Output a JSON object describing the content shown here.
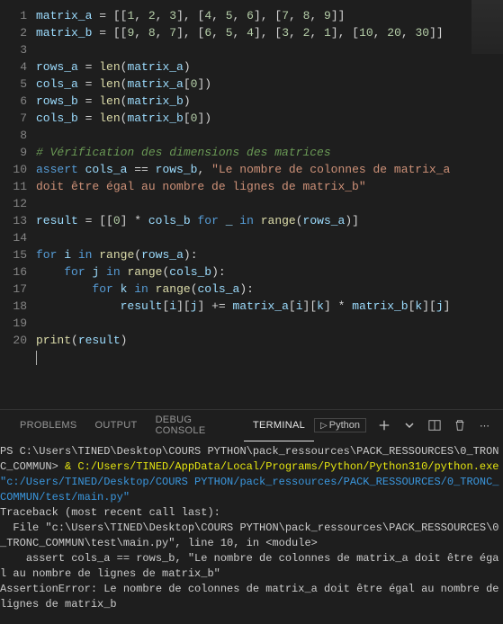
{
  "editor": {
    "lines": [
      {
        "n": "1",
        "tokens": [
          {
            "t": "var",
            "v": "matrix_a"
          },
          {
            "t": "op",
            "v": " = [["
          },
          {
            "t": "num",
            "v": "1"
          },
          {
            "t": "op",
            "v": ", "
          },
          {
            "t": "num",
            "v": "2"
          },
          {
            "t": "op",
            "v": ", "
          },
          {
            "t": "num",
            "v": "3"
          },
          {
            "t": "op",
            "v": "], ["
          },
          {
            "t": "num",
            "v": "4"
          },
          {
            "t": "op",
            "v": ", "
          },
          {
            "t": "num",
            "v": "5"
          },
          {
            "t": "op",
            "v": ", "
          },
          {
            "t": "num",
            "v": "6"
          },
          {
            "t": "op",
            "v": "], ["
          },
          {
            "t": "num",
            "v": "7"
          },
          {
            "t": "op",
            "v": ", "
          },
          {
            "t": "num",
            "v": "8"
          },
          {
            "t": "op",
            "v": ", "
          },
          {
            "t": "num",
            "v": "9"
          },
          {
            "t": "op",
            "v": "]]"
          }
        ]
      },
      {
        "n": "2",
        "tokens": [
          {
            "t": "var",
            "v": "matrix_b"
          },
          {
            "t": "op",
            "v": " = [["
          },
          {
            "t": "num",
            "v": "9"
          },
          {
            "t": "op",
            "v": ", "
          },
          {
            "t": "num",
            "v": "8"
          },
          {
            "t": "op",
            "v": ", "
          },
          {
            "t": "num",
            "v": "7"
          },
          {
            "t": "op",
            "v": "], ["
          },
          {
            "t": "num",
            "v": "6"
          },
          {
            "t": "op",
            "v": ", "
          },
          {
            "t": "num",
            "v": "5"
          },
          {
            "t": "op",
            "v": ", "
          },
          {
            "t": "num",
            "v": "4"
          },
          {
            "t": "op",
            "v": "], ["
          },
          {
            "t": "num",
            "v": "3"
          },
          {
            "t": "op",
            "v": ", "
          },
          {
            "t": "num",
            "v": "2"
          },
          {
            "t": "op",
            "v": ", "
          },
          {
            "t": "num",
            "v": "1"
          },
          {
            "t": "op",
            "v": "], ["
          },
          {
            "t": "num",
            "v": "10"
          },
          {
            "t": "op",
            "v": ", "
          },
          {
            "t": "num",
            "v": "20"
          },
          {
            "t": "op",
            "v": ", "
          },
          {
            "t": "num",
            "v": "30"
          },
          {
            "t": "op",
            "v": "]]"
          }
        ]
      },
      {
        "n": "3",
        "tokens": []
      },
      {
        "n": "4",
        "tokens": [
          {
            "t": "var",
            "v": "rows_a"
          },
          {
            "t": "op",
            "v": " = "
          },
          {
            "t": "fn",
            "v": "len"
          },
          {
            "t": "op",
            "v": "("
          },
          {
            "t": "var",
            "v": "matrix_a"
          },
          {
            "t": "op",
            "v": ")"
          }
        ]
      },
      {
        "n": "5",
        "tokens": [
          {
            "t": "var",
            "v": "cols_a"
          },
          {
            "t": "op",
            "v": " = "
          },
          {
            "t": "fn",
            "v": "len"
          },
          {
            "t": "op",
            "v": "("
          },
          {
            "t": "var",
            "v": "matrix_a"
          },
          {
            "t": "op",
            "v": "["
          },
          {
            "t": "num",
            "v": "0"
          },
          {
            "t": "op",
            "v": "])"
          }
        ]
      },
      {
        "n": "6",
        "tokens": [
          {
            "t": "var",
            "v": "rows_b"
          },
          {
            "t": "op",
            "v": " = "
          },
          {
            "t": "fn",
            "v": "len"
          },
          {
            "t": "op",
            "v": "("
          },
          {
            "t": "var",
            "v": "matrix_b"
          },
          {
            "t": "op",
            "v": ")"
          }
        ]
      },
      {
        "n": "7",
        "tokens": [
          {
            "t": "var",
            "v": "cols_b"
          },
          {
            "t": "op",
            "v": " = "
          },
          {
            "t": "fn",
            "v": "len"
          },
          {
            "t": "op",
            "v": "("
          },
          {
            "t": "var",
            "v": "matrix_b"
          },
          {
            "t": "op",
            "v": "["
          },
          {
            "t": "num",
            "v": "0"
          },
          {
            "t": "op",
            "v": "])"
          }
        ]
      },
      {
        "n": "8",
        "tokens": []
      },
      {
        "n": "9",
        "tokens": [
          {
            "t": "cmt",
            "v": "# Vérification des dimensions des matrices"
          }
        ]
      },
      {
        "n": "10",
        "tokens": [
          {
            "t": "kw",
            "v": "assert "
          },
          {
            "t": "var",
            "v": "cols_a"
          },
          {
            "t": "op",
            "v": " == "
          },
          {
            "t": "var",
            "v": "rows_b"
          },
          {
            "t": "op",
            "v": ", "
          },
          {
            "t": "str",
            "v": "\"Le nombre de colonnes de matrix_a "
          }
        ]
      },
      {
        "n": "",
        "tokens": [
          {
            "t": "str",
            "v": "doit être égal au nombre de lignes de matrix_b\""
          }
        ]
      },
      {
        "n": "11",
        "tokens": []
      },
      {
        "n": "12",
        "tokens": [
          {
            "t": "var",
            "v": "result"
          },
          {
            "t": "op",
            "v": " = [["
          },
          {
            "t": "num",
            "v": "0"
          },
          {
            "t": "op",
            "v": "] * "
          },
          {
            "t": "var",
            "v": "cols_b"
          },
          {
            "t": "kw",
            "v": " for "
          },
          {
            "t": "var",
            "v": "_"
          },
          {
            "t": "kw",
            "v": " in "
          },
          {
            "t": "fn",
            "v": "range"
          },
          {
            "t": "op",
            "v": "("
          },
          {
            "t": "var",
            "v": "rows_a"
          },
          {
            "t": "op",
            "v": ")]"
          }
        ]
      },
      {
        "n": "13",
        "tokens": []
      },
      {
        "n": "14",
        "tokens": [
          {
            "t": "kw",
            "v": "for "
          },
          {
            "t": "var",
            "v": "i"
          },
          {
            "t": "kw",
            "v": " in "
          },
          {
            "t": "fn",
            "v": "range"
          },
          {
            "t": "op",
            "v": "("
          },
          {
            "t": "var",
            "v": "rows_a"
          },
          {
            "t": "op",
            "v": "):"
          }
        ]
      },
      {
        "n": "15",
        "tokens": [
          {
            "t": "op",
            "v": "    "
          },
          {
            "t": "kw",
            "v": "for "
          },
          {
            "t": "var",
            "v": "j"
          },
          {
            "t": "kw",
            "v": " in "
          },
          {
            "t": "fn",
            "v": "range"
          },
          {
            "t": "op",
            "v": "("
          },
          {
            "t": "var",
            "v": "cols_b"
          },
          {
            "t": "op",
            "v": "):"
          }
        ]
      },
      {
        "n": "16",
        "tokens": [
          {
            "t": "op",
            "v": "        "
          },
          {
            "t": "kw",
            "v": "for "
          },
          {
            "t": "var",
            "v": "k"
          },
          {
            "t": "kw",
            "v": " in "
          },
          {
            "t": "fn",
            "v": "range"
          },
          {
            "t": "op",
            "v": "("
          },
          {
            "t": "var",
            "v": "cols_a"
          },
          {
            "t": "op",
            "v": "):"
          }
        ]
      },
      {
        "n": "17",
        "tokens": [
          {
            "t": "op",
            "v": "            "
          },
          {
            "t": "var",
            "v": "result"
          },
          {
            "t": "op",
            "v": "["
          },
          {
            "t": "var",
            "v": "i"
          },
          {
            "t": "op",
            "v": "]["
          },
          {
            "t": "var",
            "v": "j"
          },
          {
            "t": "op",
            "v": "] += "
          },
          {
            "t": "var",
            "v": "matrix_a"
          },
          {
            "t": "op",
            "v": "["
          },
          {
            "t": "var",
            "v": "i"
          },
          {
            "t": "op",
            "v": "]["
          },
          {
            "t": "var",
            "v": "k"
          },
          {
            "t": "op",
            "v": "] * "
          },
          {
            "t": "var",
            "v": "matrix_b"
          },
          {
            "t": "op",
            "v": "["
          },
          {
            "t": "var",
            "v": "k"
          },
          {
            "t": "op",
            "v": "]["
          },
          {
            "t": "var",
            "v": "j"
          },
          {
            "t": "op",
            "v": "]"
          }
        ]
      },
      {
        "n": "18",
        "tokens": []
      },
      {
        "n": "19",
        "tokens": [
          {
            "t": "fn",
            "v": "print"
          },
          {
            "t": "op",
            "v": "("
          },
          {
            "t": "var",
            "v": "result"
          },
          {
            "t": "op",
            "v": ")"
          }
        ]
      },
      {
        "n": "20",
        "tokens": []
      }
    ]
  },
  "panel": {
    "tabs": [
      {
        "label": "PROBLEMS",
        "active": false
      },
      {
        "label": "OUTPUT",
        "active": false
      },
      {
        "label": "DEBUG CONSOLE",
        "active": false
      },
      {
        "label": "TERMINAL",
        "active": true
      }
    ],
    "language": "Python"
  },
  "terminal": {
    "lines": [
      {
        "segs": [
          {
            "c": "term-white",
            "v": "PS C:\\Users\\TINED\\Desktop\\COURS PYTHON\\pack_ressources\\PACK_RESSOURCES\\0_TRONC_COMMUN> "
          },
          {
            "c": "term-yellow",
            "v": "& C:/Users/TINED/AppData/Local/Programs/Python/Python310/python.exe "
          },
          {
            "c": "term-cyan",
            "v": "\"c:/Users/TINED/Desktop/COURS PYTHON/pack_ressources/PACK_RESSOURCES/0_TRONC_COMMUN/test/main.py\""
          }
        ]
      },
      {
        "segs": [
          {
            "c": "term-white",
            "v": "Traceback (most recent call last):"
          }
        ]
      },
      {
        "segs": [
          {
            "c": "term-white",
            "v": "  File \"c:\\Users\\TINED\\Desktop\\COURS PYTHON\\pack_ressources\\PACK_RESSOURCES\\0_TRONC_COMMUN\\test\\main.py\", line 10, in <module>"
          }
        ]
      },
      {
        "segs": [
          {
            "c": "term-white",
            "v": "    assert cols_a == rows_b, \"Le nombre de colonnes de matrix_a doit être égal au nombre de lignes de matrix_b\""
          }
        ]
      },
      {
        "segs": [
          {
            "c": "term-white",
            "v": "AssertionError: Le nombre de colonnes de matrix_a doit être égal au nombre de lignes de matrix_b"
          }
        ]
      }
    ]
  }
}
